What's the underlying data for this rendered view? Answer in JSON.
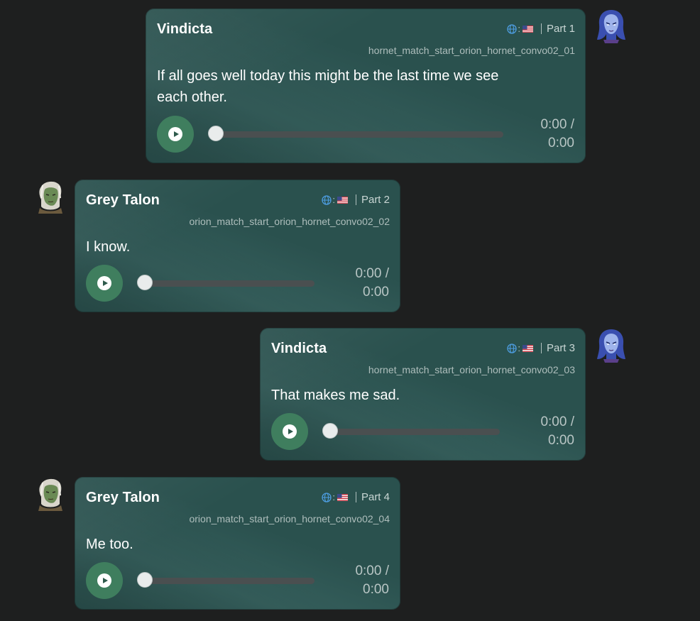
{
  "conversation": {
    "messages": [
      {
        "speaker": "Vindicta",
        "part": "Part 1",
        "filename": "hornet_match_start_orion_hornet_convo02_01",
        "text_line1": "If all goes well today this might be the last time we see",
        "text_line2": "each other.",
        "time_current": "0:00 /",
        "time_total": "0:00",
        "avatar": "vindicta-avatar",
        "progress": 0
      },
      {
        "speaker": "Grey Talon",
        "part": "Part 2",
        "filename": "orion_match_start_orion_hornet_convo02_02",
        "text_line1": "I know.",
        "time_current": "0:00 /",
        "time_total": "0:00",
        "avatar": "grey-talon-avatar",
        "progress": 0
      },
      {
        "speaker": "Vindicta",
        "part": "Part 3",
        "filename": "hornet_match_start_orion_hornet_convo02_03",
        "text_line1": "That makes me sad.",
        "time_current": "0:00 /",
        "time_total": "0:00",
        "avatar": "vindicta-avatar",
        "progress": 0
      },
      {
        "speaker": "Grey Talon",
        "part": "Part 4",
        "filename": "orion_match_start_orion_hornet_convo02_04",
        "text_line1": "Me too.",
        "time_current": "0:00 /",
        "time_total": "0:00",
        "avatar": "grey-talon-avatar",
        "progress": 0
      }
    ],
    "language_colon": ":",
    "icons": {
      "language": "globe-icon",
      "flag": "us-flag-icon",
      "play": "play-icon"
    },
    "colors": {
      "bubble": "#2f5a57",
      "play_button": "#3f7e5e",
      "track": "#4a4f50",
      "background": "#1e1f1f"
    }
  }
}
